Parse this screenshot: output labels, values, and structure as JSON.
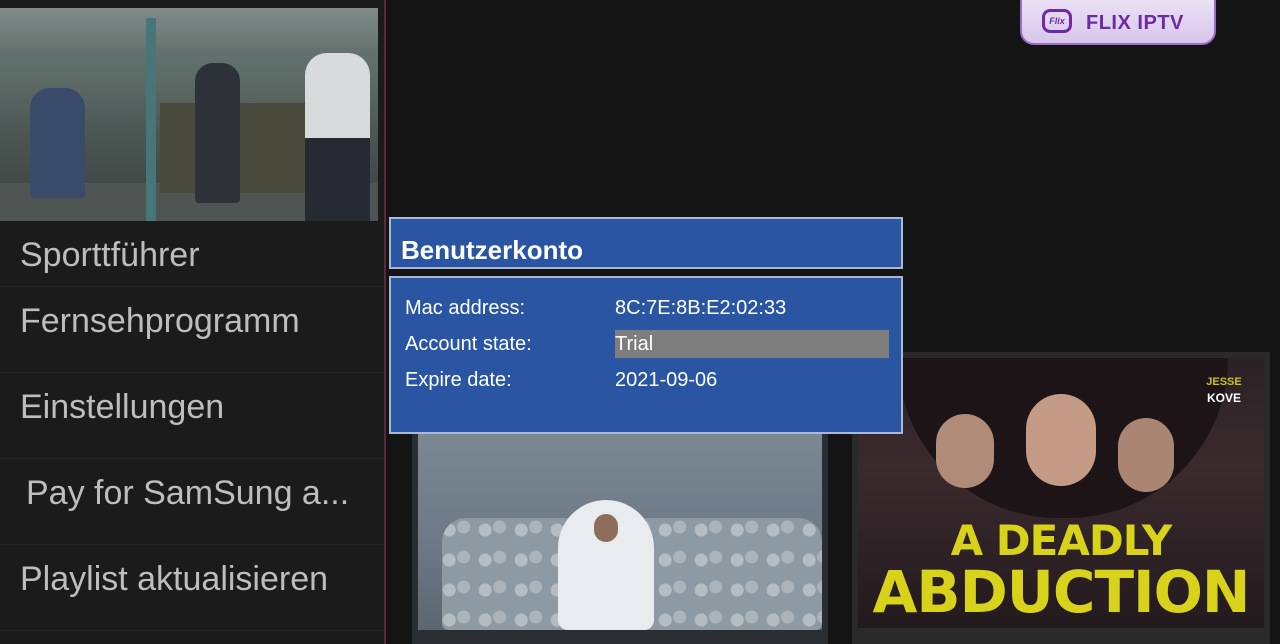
{
  "sidebar": {
    "menu": [
      {
        "label": "Sporttführer"
      },
      {
        "label": "Fernsehprogramm"
      },
      {
        "label": "Einstellungen"
      },
      {
        "label": "Pay for SamSung a..."
      },
      {
        "label": "Playlist aktualisieren"
      }
    ]
  },
  "logo": {
    "mark_text": "Flix",
    "name": "FLIX IPTV"
  },
  "dialog": {
    "title": "Benutzerkonto",
    "rows": [
      {
        "label": "Mac address:",
        "value": "8C:7E:8B:E2:02:33"
      },
      {
        "label": "Account state:",
        "value": "Trial"
      },
      {
        "label": "Expire date:",
        "value": "2021-09-06"
      }
    ]
  },
  "posters": {
    "right": {
      "credit_first": "JESSE",
      "credit_last": "KOVE",
      "title_line1": "A DEADLY",
      "title_line2": "ABDUCTION"
    }
  }
}
